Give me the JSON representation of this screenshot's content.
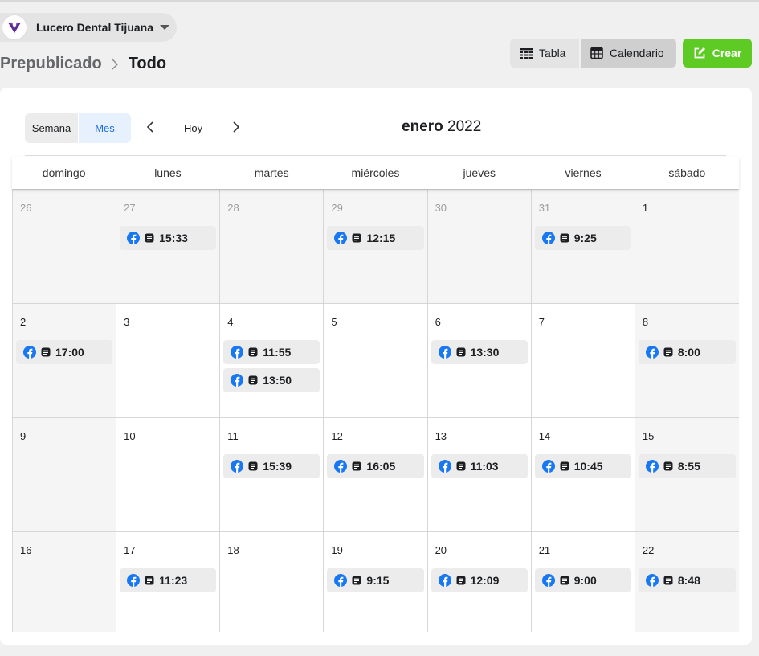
{
  "account": {
    "name": "Lucero Dental Tijuana"
  },
  "breadcrumb": {
    "parent": "Prepublicado",
    "current": "Todo"
  },
  "views": {
    "table_label": "Tabla",
    "calendar_label": "Calendario",
    "create_label": "Crear"
  },
  "calendar": {
    "segment": {
      "week_label": "Semana",
      "month_label": "Mes",
      "selected": "Mes"
    },
    "today_label": "Hoy",
    "month": "enero",
    "year": "2022",
    "weekdays": [
      "domingo",
      "lunes",
      "martes",
      "miércoles",
      "jueves",
      "viernes",
      "sábado"
    ],
    "weeks": [
      [
        {
          "day": "26",
          "other": true,
          "events": []
        },
        {
          "day": "27",
          "other": true,
          "events": [
            "15:33"
          ]
        },
        {
          "day": "28",
          "other": true,
          "events": []
        },
        {
          "day": "29",
          "other": true,
          "events": [
            "12:15"
          ]
        },
        {
          "day": "30",
          "other": true,
          "events": []
        },
        {
          "day": "31",
          "other": true,
          "events": [
            "9:25"
          ]
        },
        {
          "day": "1",
          "other": false,
          "events": []
        }
      ],
      [
        {
          "day": "2",
          "other": false,
          "events": [
            "17:00"
          ]
        },
        {
          "day": "3",
          "other": false,
          "events": []
        },
        {
          "day": "4",
          "other": false,
          "events": [
            "11:55",
            "13:50"
          ]
        },
        {
          "day": "5",
          "other": false,
          "events": []
        },
        {
          "day": "6",
          "other": false,
          "events": [
            "13:30"
          ]
        },
        {
          "day": "7",
          "other": false,
          "events": []
        },
        {
          "day": "8",
          "other": false,
          "events": [
            "8:00"
          ]
        }
      ],
      [
        {
          "day": "9",
          "other": false,
          "events": []
        },
        {
          "day": "10",
          "other": false,
          "events": []
        },
        {
          "day": "11",
          "other": false,
          "events": [
            "15:39"
          ]
        },
        {
          "day": "12",
          "other": false,
          "events": [
            "16:05"
          ]
        },
        {
          "day": "13",
          "other": false,
          "events": [
            "11:03"
          ]
        },
        {
          "day": "14",
          "other": false,
          "events": [
            "10:45"
          ]
        },
        {
          "day": "15",
          "other": false,
          "events": [
            "8:55"
          ]
        }
      ],
      [
        {
          "day": "16",
          "other": false,
          "events": []
        },
        {
          "day": "17",
          "other": false,
          "events": [
            "11:23"
          ]
        },
        {
          "day": "18",
          "other": false,
          "events": []
        },
        {
          "day": "19",
          "other": false,
          "events": [
            "9:15"
          ]
        },
        {
          "day": "20",
          "other": false,
          "events": [
            "12:09"
          ]
        },
        {
          "day": "21",
          "other": false,
          "events": [
            "9:00"
          ]
        },
        {
          "day": "22",
          "other": false,
          "events": [
            "8:48"
          ]
        }
      ]
    ]
  },
  "icons": {
    "post_platform": "facebook-icon",
    "post_type": "document-icon"
  },
  "colors": {
    "accent_create": "#5ecb24",
    "facebook_blue": "#1877f2",
    "selected_segment": "#1b6ee0"
  }
}
